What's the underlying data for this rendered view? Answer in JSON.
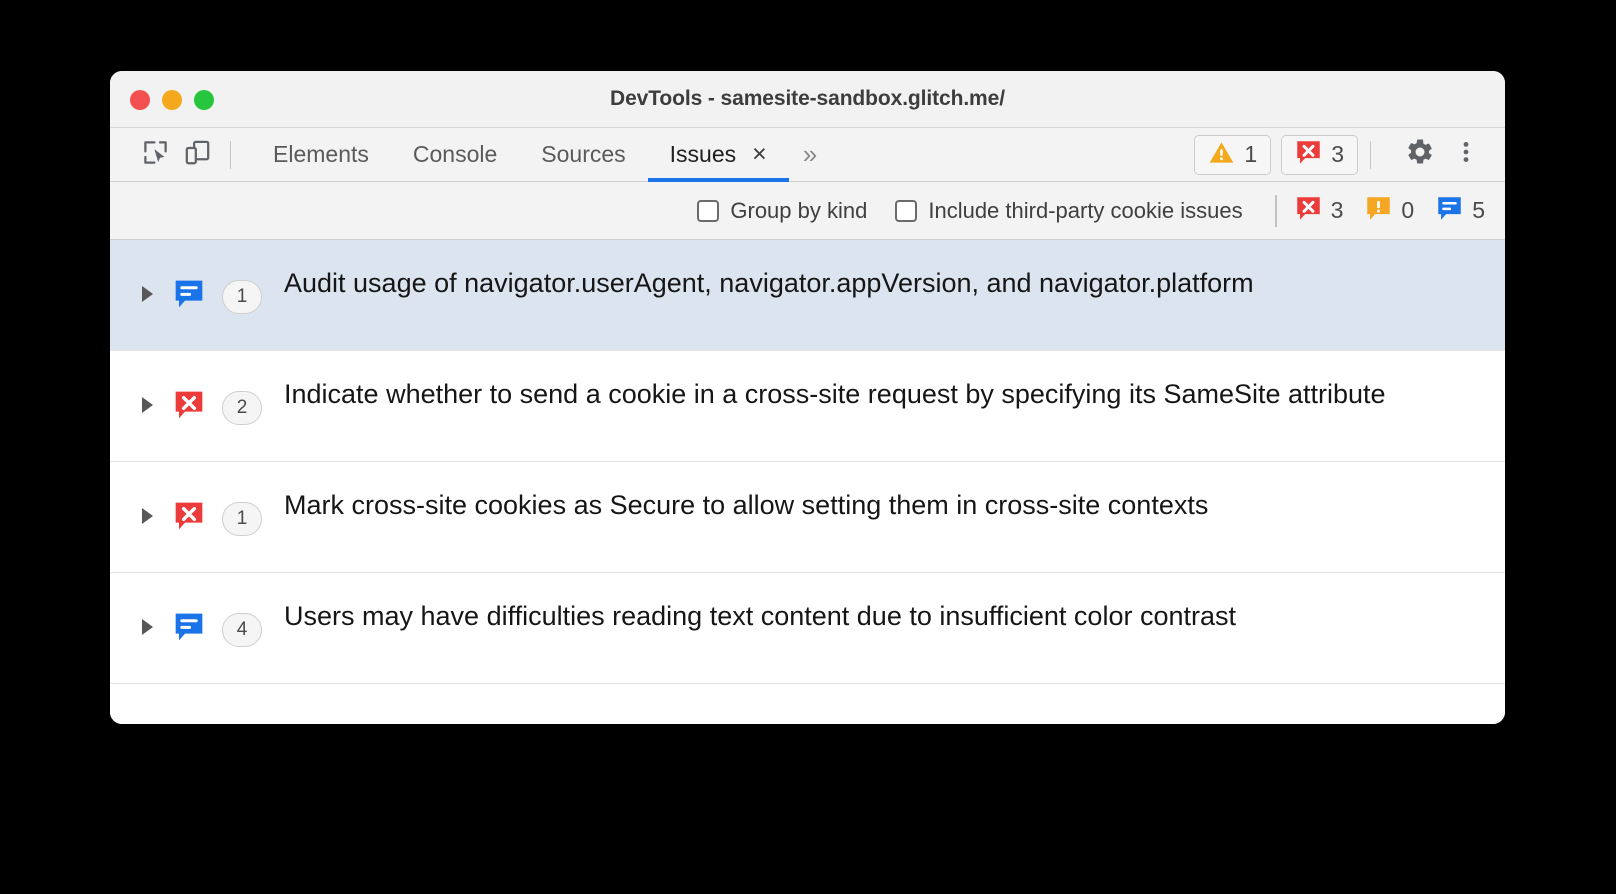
{
  "window": {
    "title": "DevTools - samesite-sandbox.glitch.me/",
    "traffic_lights": [
      {
        "name": "close",
        "color": "#f3514f"
      },
      {
        "name": "minimize",
        "color": "#f4a91d"
      },
      {
        "name": "maximize",
        "color": "#28c63f"
      }
    ]
  },
  "toolbar": {
    "inspect_icon": "inspect-element-icon",
    "device_icon": "device-toolbar-icon",
    "overflow_label": "»",
    "gear_icon": "gear-icon",
    "more_icon": "more-vertical-icon",
    "tabs": [
      {
        "label": "Elements",
        "active": false,
        "closeable": false
      },
      {
        "label": "Console",
        "active": false,
        "closeable": false
      },
      {
        "label": "Sources",
        "active": false,
        "closeable": false
      },
      {
        "label": "Issues",
        "active": true,
        "closeable": true,
        "close_label": "×"
      }
    ],
    "status_counters": [
      {
        "icon": "warning-triangle-icon",
        "color": "#f4a91d",
        "count": "1"
      },
      {
        "icon": "error-bubble-icon",
        "color": "#eb3b3b",
        "count": "3"
      }
    ]
  },
  "filterbar": {
    "checkboxes": [
      {
        "label": "Group by kind",
        "checked": false
      },
      {
        "label": "Include third-party cookie issues",
        "checked": false
      }
    ],
    "counters": [
      {
        "icon": "error-bubble-icon",
        "color": "#eb3b3b",
        "count": "3"
      },
      {
        "icon": "warning-bubble-icon",
        "color": "#f5a623",
        "count": "0"
      },
      {
        "icon": "info-bubble-icon",
        "color": "#1a73e8",
        "count": "5"
      }
    ]
  },
  "issues": [
    {
      "kind": "info",
      "icon": "info-bubble-icon",
      "color": "#1a73e8",
      "count": "1",
      "title": "Audit usage of navigator.userAgent, navigator.appVersion, and navigator.platform",
      "selected": true,
      "expanded": false
    },
    {
      "kind": "error",
      "icon": "error-bubble-icon",
      "color": "#eb3b3b",
      "count": "2",
      "title": "Indicate whether to send a cookie in a cross-site request by specifying its SameSite attribute",
      "selected": false,
      "expanded": false
    },
    {
      "kind": "error",
      "icon": "error-bubble-icon",
      "color": "#eb3b3b",
      "count": "1",
      "title": "Mark cross-site cookies as Secure to allow setting them in cross-site contexts",
      "selected": false,
      "expanded": false
    },
    {
      "kind": "info",
      "icon": "info-bubble-icon",
      "color": "#1a73e8",
      "count": "4",
      "title": "Users may have difficulties reading text content due to insufficient color contrast",
      "selected": false,
      "expanded": false
    }
  ],
  "colors": {
    "accent": "#1a73e8",
    "error": "#eb3b3b",
    "warning": "#f5a623",
    "selection": "#dce4f0",
    "chrome": "#f3f3f3"
  }
}
